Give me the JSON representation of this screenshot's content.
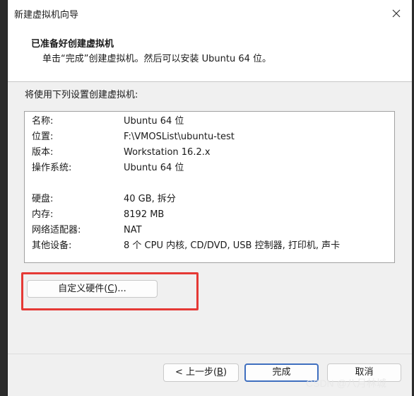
{
  "window": {
    "title": "新建虚拟机向导",
    "close_icon": "close-icon"
  },
  "header": {
    "title": "已准备好创建虚拟机",
    "subtitle": "单击“完成”创建虚拟机。然后可以安装 Ubuntu 64 位。"
  },
  "intro": "将使用下列设置创建虚拟机:",
  "summary": {
    "rows": [
      {
        "label": "名称:",
        "value": "Ubuntu 64 位"
      },
      {
        "label": "位置:",
        "value": "F:\\VMOSList\\ubuntu-test"
      },
      {
        "label": "版本:",
        "value": "Workstation 16.2.x"
      },
      {
        "label": "操作系统:",
        "value": "Ubuntu 64 位"
      },
      {
        "label": "硬盘:",
        "value": "40 GB, 拆分"
      },
      {
        "label": "内存:",
        "value": "8192 MB"
      },
      {
        "label": "网络适配器:",
        "value": "NAT"
      },
      {
        "label": "其他设备:",
        "value": "8 个 CPU 内核, CD/DVD, USB 控制器, 打印机, 声卡"
      }
    ]
  },
  "customize_hw": {
    "pre": "自定义硬件(",
    "key": "C",
    "post": ")..."
  },
  "buttons": {
    "back": {
      "pre": "< 上一步(",
      "key": "B",
      "post": ")"
    },
    "finish": "完成",
    "cancel": "取消"
  },
  "watermark": "CSDN @八月林城",
  "colors": {
    "highlight": "#e53935",
    "primary_border": "#3f6fbf"
  }
}
